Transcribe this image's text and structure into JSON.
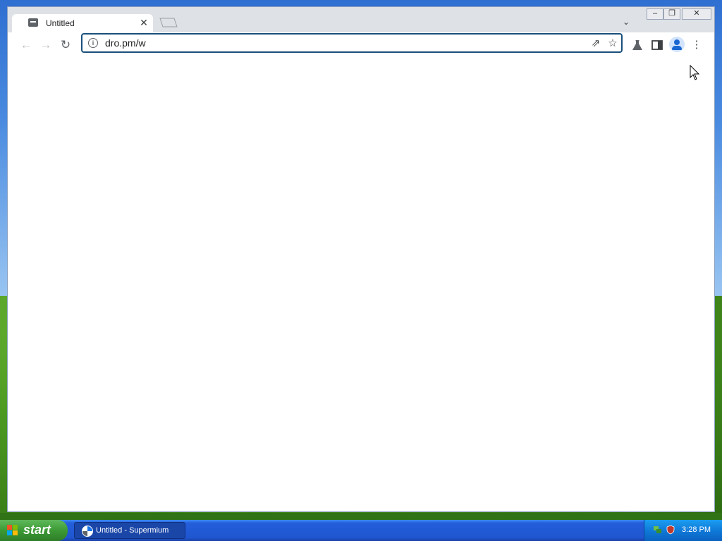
{
  "browser": {
    "tab": {
      "title": "Untitled",
      "close_icon": "close-icon",
      "favicon": "page-icon"
    },
    "new_tab_icon": "new-tab-icon",
    "tab_search_icon": "chevron-down-icon",
    "window_controls": {
      "minimize": "minimize-icon",
      "restore": "restore-icon",
      "close": "close-icon"
    },
    "toolbar": {
      "back_icon": "back-arrow-icon",
      "forward_icon": "forward-arrow-icon",
      "reload_icon": "reload-icon",
      "address": {
        "value": "dro.pm/w",
        "info_icon": "info-icon"
      },
      "share_icon": "share-icon",
      "bookmark_icon": "star-icon",
      "labs_icon": "flask-icon",
      "side_panel_icon": "side-panel-icon",
      "profile_icon": "profile-icon",
      "menu_icon": "kebab-menu-icon"
    }
  },
  "taskbar": {
    "start_label": "start",
    "task_label": "Untitled - Supermium",
    "clock": "3:28 PM"
  }
}
